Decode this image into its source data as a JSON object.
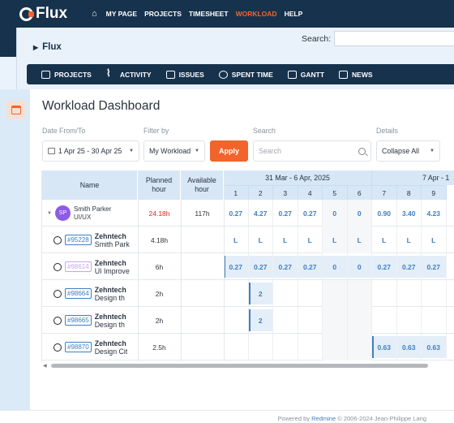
{
  "app": {
    "name": "Flux"
  },
  "topnav": [
    "MY PAGE",
    "PROJECTS",
    "TIMESHEET",
    "WORKLOAD",
    "HELP"
  ],
  "header": {
    "breadcrumb": "Flux",
    "search_label": "Search:"
  },
  "subnav": [
    "PROJECTS",
    "ACTIVITY",
    "ISSUES",
    "SPENT TIME",
    "GANTT",
    "NEWS"
  ],
  "page": {
    "title": "Workload Dashboard"
  },
  "filters": {
    "date_label": "Date From/To",
    "date_value": "1 Apr 25 - 30 Apr 25",
    "filter_label": "Filter by",
    "filter_value": "My Workload",
    "apply_label": "Apply",
    "search_label": "Search",
    "search_placeholder": "Search",
    "details_label": "Details",
    "details_value": "Collapse All"
  },
  "grid": {
    "col_name": "Name",
    "col_planned": "Planned hour",
    "col_available": "Available hour",
    "week1": "31 Mar - 6 Apr, 2025",
    "week2": "7 Apr - 1",
    "days": [
      "1",
      "2",
      "3",
      "4",
      "5",
      "6",
      "7",
      "8",
      "9"
    ],
    "user": {
      "initials": "SP",
      "name": "Smith Parker",
      "role": "UI/UX",
      "planned": "24.18h",
      "available": "117h",
      "values": [
        "0.27",
        "4.27",
        "0.27",
        "0.27",
        "0",
        "0",
        "0.90",
        "3.40",
        "4.23"
      ]
    },
    "rows": [
      {
        "ticket": "#95228",
        "project": "Zehntech",
        "sub": "Smith Park",
        "planned": "4.18h",
        "values": [
          "L",
          "L",
          "L",
          "L",
          "L",
          "L",
          "L",
          "L",
          "L"
        ]
      },
      {
        "ticket": "#98614",
        "project": "Zehntech",
        "sub": "UI Improve",
        "planned": "6h",
        "values": [
          "0.27",
          "0.27",
          "0.27",
          "0.27",
          "0",
          "0",
          "0.27",
          "0.27",
          "0.27"
        ]
      },
      {
        "ticket": "#98664",
        "project": "Zehntech",
        "sub": "Design th",
        "planned": "2h",
        "values": [
          "",
          "2",
          "",
          "",
          "",
          "",
          "",
          "",
          ""
        ]
      },
      {
        "ticket": "#98665",
        "project": "Zehntech",
        "sub": "Design th",
        "planned": "2h",
        "values": [
          "",
          "2",
          "",
          "",
          "",
          "",
          "",
          "",
          ""
        ]
      },
      {
        "ticket": "#98870",
        "project": "Zehntech",
        "sub": "Design Cit",
        "planned": "2.5h",
        "values": [
          "",
          "",
          "",
          "",
          "",
          "",
          "0.63",
          "0.63",
          "0.63"
        ]
      }
    ]
  },
  "footer": {
    "prefix": "Powered by ",
    "link": "Redmine",
    "suffix": " © 2006-2024 Jean-Philippe Lang"
  },
  "colors": {
    "navy": "#17324d",
    "accent": "#f2642c",
    "link": "#3f7ec2",
    "over": "#e02424"
  }
}
